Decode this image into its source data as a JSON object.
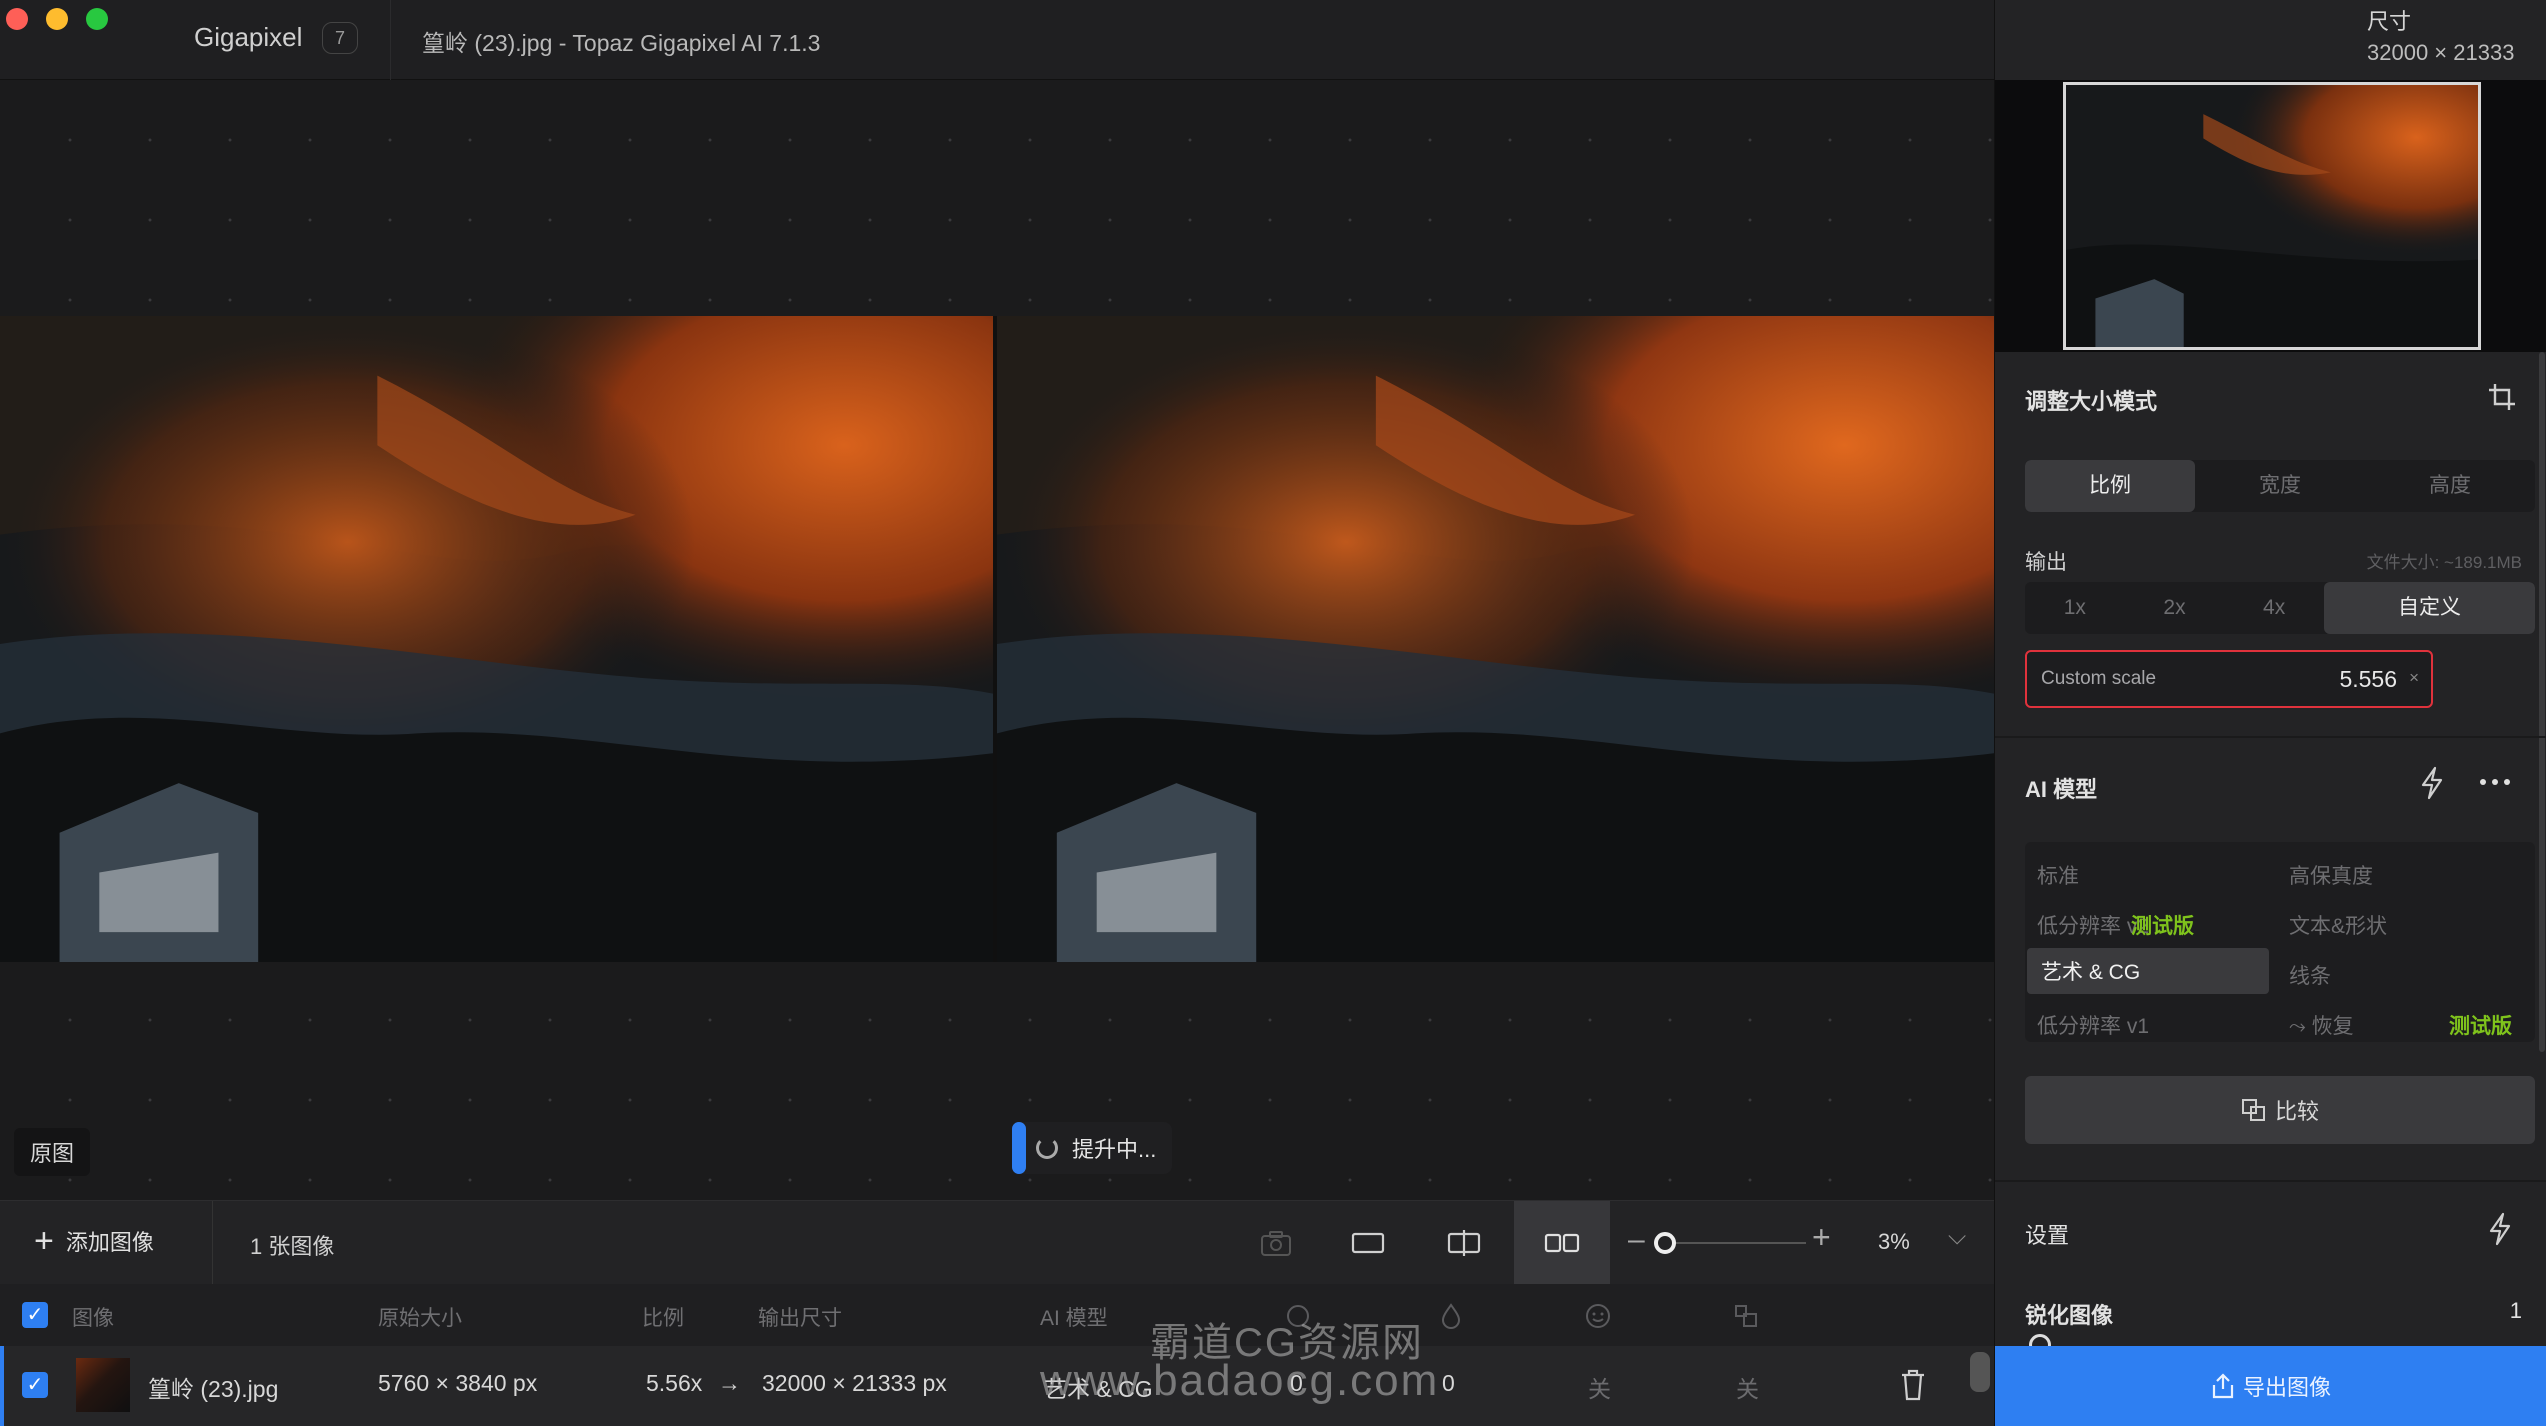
{
  "window": {
    "app_name": "Gigapixel",
    "badge_count": "7",
    "title": "篁岭 (23).jpg - Topaz Gigapixel AI 7.1.3"
  },
  "viewer": {
    "original_label": "原图",
    "progress_text": "提升中..."
  },
  "toolbar": {
    "add_image": "添加图像",
    "image_count": "1 张图像",
    "zoom_value": "3%",
    "zoom_level": 0.03
  },
  "table": {
    "headers": [
      "图像",
      "原始大小",
      "比例",
      "输出尺寸",
      "AI 模型"
    ],
    "row": {
      "filename": "篁岭 (23).jpg",
      "original_size": "5760 × 3840 px",
      "scale": "5.56x",
      "arrow": "→",
      "output_size": "32000 × 21333 px",
      "model": "艺术 & CG",
      "col_a": "0",
      "col_b": "0",
      "col_c": "关",
      "col_d": "关"
    }
  },
  "watermark": {
    "line1": "霸道CG资源网",
    "line2": "www.badaocg.com"
  },
  "panel": {
    "size_label": "尺寸",
    "size_value": "32000 × 21333",
    "resize_mode_title": "调整大小模式",
    "resize_modes": [
      "比例",
      "宽度",
      "高度"
    ],
    "resize_mode_selected": "比例",
    "output_label": "输出",
    "file_size": "文件大小: ~189.1MB",
    "scales": [
      "1x",
      "2x",
      "4x",
      "自定义"
    ],
    "scale_selected": "自定义",
    "custom_scale_label": "Custom scale",
    "custom_scale_value": "5.556",
    "clear_symbol": "×",
    "ai_model_title": "AI 模型",
    "models": {
      "standard": "标准",
      "high_fidelity": "高保真度",
      "low_res_v2": "低分辨率 v2",
      "text_shapes": "文本&形状",
      "art_cg": "艺术 & CG",
      "lines": "线条",
      "low_res_v1": "低分辨率 v1",
      "restore": "恢复"
    },
    "model_selected": "艺术 & CG",
    "beta_label": "测试版",
    "compare_button": "比较",
    "settings_title": "设置",
    "sharpen_label": "锐化图像",
    "sharpen_value": "1",
    "export_button": "导出图像"
  },
  "colors": {
    "accent_blue": "#2e7ff2",
    "beta_green": "#7fc31c",
    "error_red": "#e0323c",
    "panel_bg": "#232325"
  }
}
